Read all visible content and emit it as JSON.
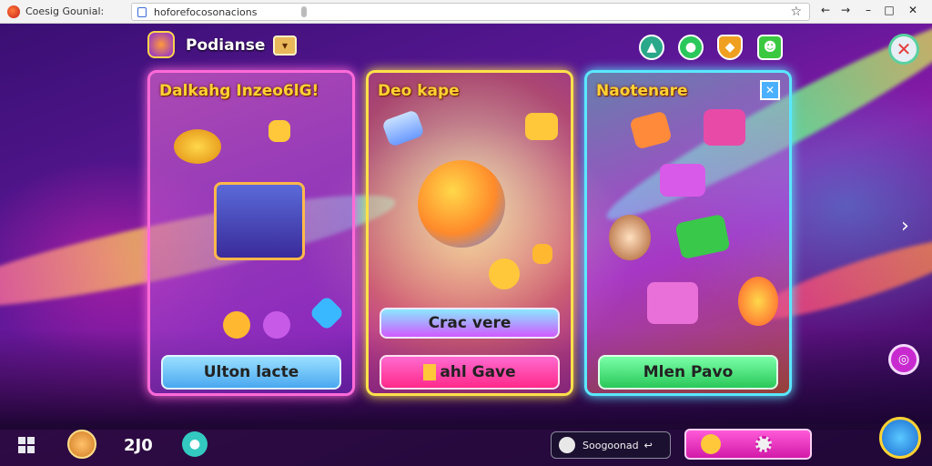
{
  "browser": {
    "tab_title": "Coesig Gounial:",
    "url": "hoforefocosonacions",
    "star_icon": "star-icon",
    "controls": {
      "back": "←",
      "forward": "→",
      "minimize": "–",
      "maximize": "□",
      "close": "✕"
    }
  },
  "header": {
    "title": "Podianse",
    "dropdown_glyph": "▾",
    "icons": [
      "triangle-badge-icon",
      "green-orb-icon",
      "shield-icon",
      "robot-icon"
    ],
    "close_glyph": "✕"
  },
  "cards": [
    {
      "title": "Dalkahg Inzeo6lG!",
      "button": "Ulton lacte"
    },
    {
      "title": "Deo kape",
      "secondary_button": "Crac vere",
      "button": "ahl Gave"
    },
    {
      "title": "Naotenare",
      "button": "Mlen Pavo",
      "corner_glyph": "✕"
    }
  ],
  "side": {
    "next_glyph": "›",
    "round_glyph": "◎"
  },
  "taskbar": {
    "count": "2J0",
    "suggestion_text": "Soogoonad",
    "suggestion_arrow": "↩",
    "teal_glyph": "●"
  },
  "colors": {
    "card1_border": "#ff6ad8",
    "card2_border": "#ffe14a",
    "card3_border": "#5ae8ff",
    "title_yellow": "#ffd233",
    "btn_blue": "#6ac8ff",
    "btn_pink": "#ff3ab0",
    "btn_green": "#3ae88a"
  }
}
